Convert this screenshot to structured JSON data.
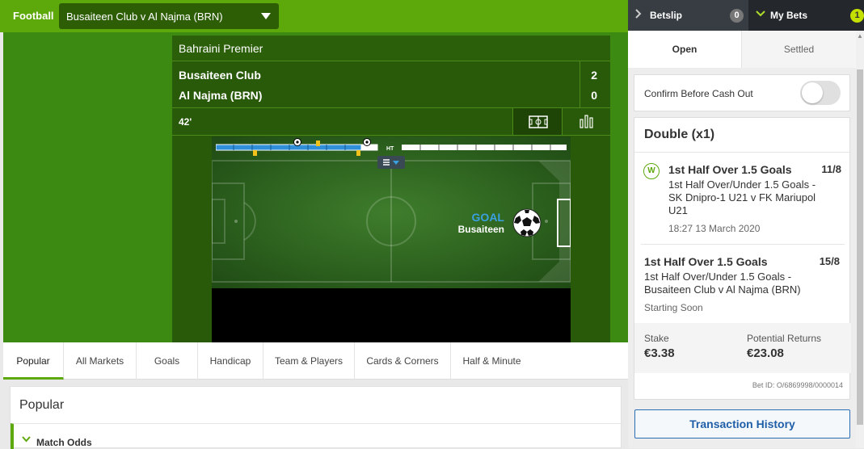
{
  "header": {
    "sport_label": "Football",
    "match_select": "Busaiteen Club v Al Najma (BRN)"
  },
  "match": {
    "league": "Bahraini Premier",
    "home_team": "Busaiteen Club",
    "away_team": "Al Najma (BRN)",
    "home_score": "2",
    "away_score": "0",
    "time": "42'",
    "timeline_ht_label": "HT",
    "goal_label": "GOAL",
    "goal_team": "Busaiteen"
  },
  "market_tabs": [
    "Popular",
    "All Markets",
    "Goals",
    "Handicap",
    "Team & Players",
    "Cards & Corners",
    "Half & Minute"
  ],
  "popular_section": {
    "title": "Popular",
    "first_market": "Match Odds"
  },
  "betslip": {
    "betslip_label": "Betslip",
    "betslip_count": "0",
    "mybets_label": "My Bets",
    "mybets_count": "1",
    "open_tab": "Open",
    "settled_tab": "Settled",
    "confirm_label": "Confirm Before Cash Out",
    "bet": {
      "type": "Double (x1)",
      "legs": [
        {
          "badge": "W",
          "title": "1st Half Over 1.5 Goals",
          "odds": "11/8",
          "desc_lines": [
            "1st Half Over/Under 1.5 Goals -",
            "SK Dnipro-1 U21 v FK Mariupol",
            "U21"
          ],
          "meta": "18:27 13 March 2020"
        },
        {
          "title": "1st Half Over 1.5 Goals",
          "odds": "15/8",
          "desc_lines": [
            "1st Half Over/Under 1.5 Goals -",
            "Busaiteen Club v Al Najma (BRN)"
          ],
          "meta": "Starting Soon"
        }
      ],
      "stake_label": "Stake",
      "stake_value": "€3.38",
      "returns_label": "Potential Returns",
      "returns_value": "€23.08",
      "bet_id": "Bet ID: O/6869998/0000014"
    },
    "transaction_history": "Transaction History"
  },
  "colors": {
    "brand_green": "#5da80b",
    "dark_green": "#285a09",
    "link_blue": "#1f5fa8",
    "timeline_blue": "#2f8fd8",
    "card_yellow": "#f2c21b"
  }
}
